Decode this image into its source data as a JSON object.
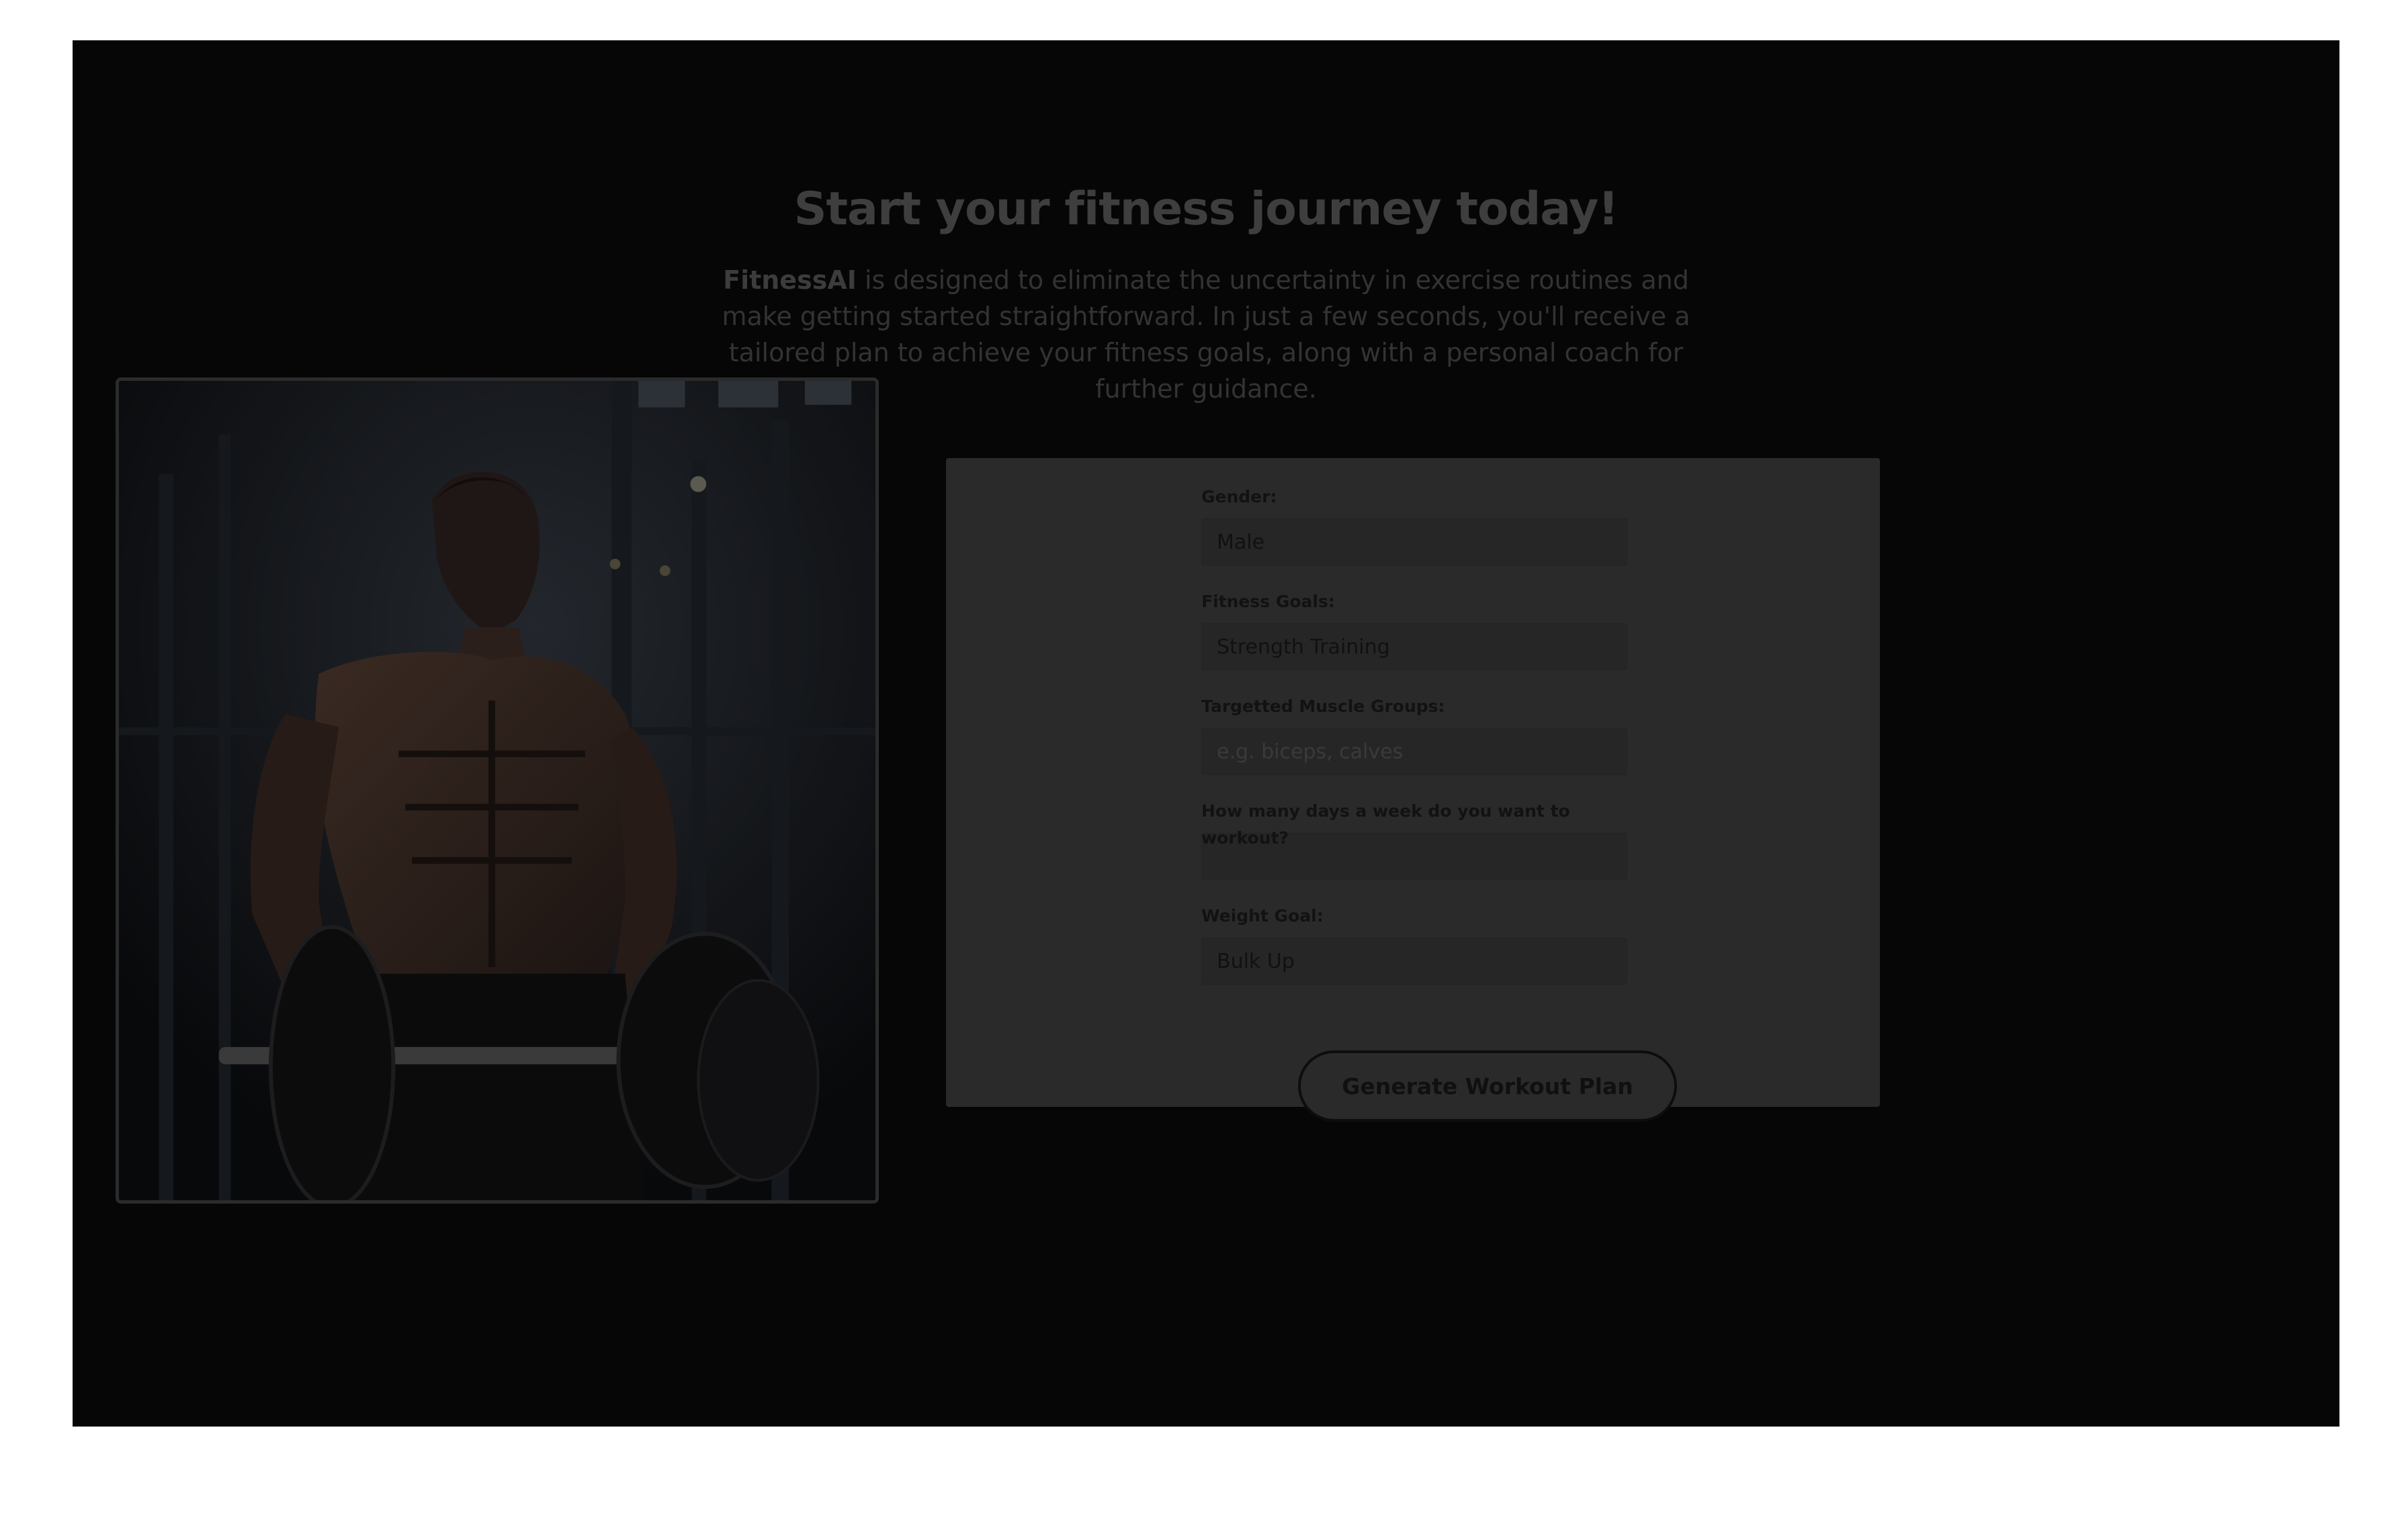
{
  "hero": {
    "title": "Start your fitness journey today!",
    "brand": "FitnessAI",
    "description": " is designed to eliminate the uncertainty in exercise routines and make getting started straightforward. In just a few seconds, you'll receive a tailored plan to achieve your fitness goals, along with a personal coach for further guidance."
  },
  "form": {
    "gender": {
      "label": "Gender:",
      "value": "Male"
    },
    "fitness_goals": {
      "label": "Fitness Goals:",
      "value": "Strength Training"
    },
    "muscle_groups": {
      "label": "Targetted Muscle Groups:",
      "placeholder": "e.g. biceps, calves"
    },
    "days_per_week": {
      "label": "How many days a week do you want to workout?",
      "value": ""
    },
    "weight_goal": {
      "label": "Weight Goal:",
      "value": "Bulk Up"
    },
    "submit_label": "Generate Workout Plan"
  }
}
